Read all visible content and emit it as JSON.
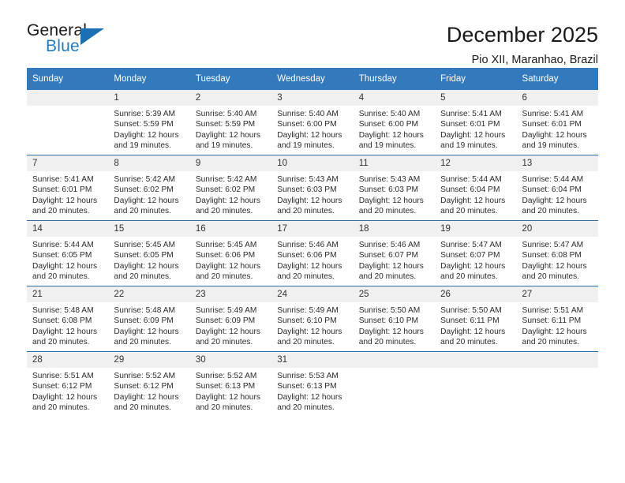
{
  "logo": {
    "word_top": "General",
    "word_bottom": "Blue",
    "triangle_color": "#1a6fb5",
    "blue_color": "#1f7cc4"
  },
  "header": {
    "title": "December 2025",
    "subtitle": "Pio XII, Maranhao, Brazil"
  },
  "calendar": {
    "header_bg": "#3279bd",
    "header_text_color": "#ffffff",
    "daynum_bg": "#f0f0f0",
    "row_divider_color": "#2e6da4",
    "weekdays": [
      "Sunday",
      "Monday",
      "Tuesday",
      "Wednesday",
      "Thursday",
      "Friday",
      "Saturday"
    ],
    "weeks": [
      [
        {
          "day": "",
          "sunrise": "",
          "sunset": "",
          "daylight_1": "",
          "daylight_2": ""
        },
        {
          "day": "1",
          "sunrise": "Sunrise: 5:39 AM",
          "sunset": "Sunset: 5:59 PM",
          "daylight_1": "Daylight: 12 hours",
          "daylight_2": "and 19 minutes."
        },
        {
          "day": "2",
          "sunrise": "Sunrise: 5:40 AM",
          "sunset": "Sunset: 5:59 PM",
          "daylight_1": "Daylight: 12 hours",
          "daylight_2": "and 19 minutes."
        },
        {
          "day": "3",
          "sunrise": "Sunrise: 5:40 AM",
          "sunset": "Sunset: 6:00 PM",
          "daylight_1": "Daylight: 12 hours",
          "daylight_2": "and 19 minutes."
        },
        {
          "day": "4",
          "sunrise": "Sunrise: 5:40 AM",
          "sunset": "Sunset: 6:00 PM",
          "daylight_1": "Daylight: 12 hours",
          "daylight_2": "and 19 minutes."
        },
        {
          "day": "5",
          "sunrise": "Sunrise: 5:41 AM",
          "sunset": "Sunset: 6:01 PM",
          "daylight_1": "Daylight: 12 hours",
          "daylight_2": "and 19 minutes."
        },
        {
          "day": "6",
          "sunrise": "Sunrise: 5:41 AM",
          "sunset": "Sunset: 6:01 PM",
          "daylight_1": "Daylight: 12 hours",
          "daylight_2": "and 19 minutes."
        }
      ],
      [
        {
          "day": "7",
          "sunrise": "Sunrise: 5:41 AM",
          "sunset": "Sunset: 6:01 PM",
          "daylight_1": "Daylight: 12 hours",
          "daylight_2": "and 20 minutes."
        },
        {
          "day": "8",
          "sunrise": "Sunrise: 5:42 AM",
          "sunset": "Sunset: 6:02 PM",
          "daylight_1": "Daylight: 12 hours",
          "daylight_2": "and 20 minutes."
        },
        {
          "day": "9",
          "sunrise": "Sunrise: 5:42 AM",
          "sunset": "Sunset: 6:02 PM",
          "daylight_1": "Daylight: 12 hours",
          "daylight_2": "and 20 minutes."
        },
        {
          "day": "10",
          "sunrise": "Sunrise: 5:43 AM",
          "sunset": "Sunset: 6:03 PM",
          "daylight_1": "Daylight: 12 hours",
          "daylight_2": "and 20 minutes."
        },
        {
          "day": "11",
          "sunrise": "Sunrise: 5:43 AM",
          "sunset": "Sunset: 6:03 PM",
          "daylight_1": "Daylight: 12 hours",
          "daylight_2": "and 20 minutes."
        },
        {
          "day": "12",
          "sunrise": "Sunrise: 5:44 AM",
          "sunset": "Sunset: 6:04 PM",
          "daylight_1": "Daylight: 12 hours",
          "daylight_2": "and 20 minutes."
        },
        {
          "day": "13",
          "sunrise": "Sunrise: 5:44 AM",
          "sunset": "Sunset: 6:04 PM",
          "daylight_1": "Daylight: 12 hours",
          "daylight_2": "and 20 minutes."
        }
      ],
      [
        {
          "day": "14",
          "sunrise": "Sunrise: 5:44 AM",
          "sunset": "Sunset: 6:05 PM",
          "daylight_1": "Daylight: 12 hours",
          "daylight_2": "and 20 minutes."
        },
        {
          "day": "15",
          "sunrise": "Sunrise: 5:45 AM",
          "sunset": "Sunset: 6:05 PM",
          "daylight_1": "Daylight: 12 hours",
          "daylight_2": "and 20 minutes."
        },
        {
          "day": "16",
          "sunrise": "Sunrise: 5:45 AM",
          "sunset": "Sunset: 6:06 PM",
          "daylight_1": "Daylight: 12 hours",
          "daylight_2": "and 20 minutes."
        },
        {
          "day": "17",
          "sunrise": "Sunrise: 5:46 AM",
          "sunset": "Sunset: 6:06 PM",
          "daylight_1": "Daylight: 12 hours",
          "daylight_2": "and 20 minutes."
        },
        {
          "day": "18",
          "sunrise": "Sunrise: 5:46 AM",
          "sunset": "Sunset: 6:07 PM",
          "daylight_1": "Daylight: 12 hours",
          "daylight_2": "and 20 minutes."
        },
        {
          "day": "19",
          "sunrise": "Sunrise: 5:47 AM",
          "sunset": "Sunset: 6:07 PM",
          "daylight_1": "Daylight: 12 hours",
          "daylight_2": "and 20 minutes."
        },
        {
          "day": "20",
          "sunrise": "Sunrise: 5:47 AM",
          "sunset": "Sunset: 6:08 PM",
          "daylight_1": "Daylight: 12 hours",
          "daylight_2": "and 20 minutes."
        }
      ],
      [
        {
          "day": "21",
          "sunrise": "Sunrise: 5:48 AM",
          "sunset": "Sunset: 6:08 PM",
          "daylight_1": "Daylight: 12 hours",
          "daylight_2": "and 20 minutes."
        },
        {
          "day": "22",
          "sunrise": "Sunrise: 5:48 AM",
          "sunset": "Sunset: 6:09 PM",
          "daylight_1": "Daylight: 12 hours",
          "daylight_2": "and 20 minutes."
        },
        {
          "day": "23",
          "sunrise": "Sunrise: 5:49 AM",
          "sunset": "Sunset: 6:09 PM",
          "daylight_1": "Daylight: 12 hours",
          "daylight_2": "and 20 minutes."
        },
        {
          "day": "24",
          "sunrise": "Sunrise: 5:49 AM",
          "sunset": "Sunset: 6:10 PM",
          "daylight_1": "Daylight: 12 hours",
          "daylight_2": "and 20 minutes."
        },
        {
          "day": "25",
          "sunrise": "Sunrise: 5:50 AM",
          "sunset": "Sunset: 6:10 PM",
          "daylight_1": "Daylight: 12 hours",
          "daylight_2": "and 20 minutes."
        },
        {
          "day": "26",
          "sunrise": "Sunrise: 5:50 AM",
          "sunset": "Sunset: 6:11 PM",
          "daylight_1": "Daylight: 12 hours",
          "daylight_2": "and 20 minutes."
        },
        {
          "day": "27",
          "sunrise": "Sunrise: 5:51 AM",
          "sunset": "Sunset: 6:11 PM",
          "daylight_1": "Daylight: 12 hours",
          "daylight_2": "and 20 minutes."
        }
      ],
      [
        {
          "day": "28",
          "sunrise": "Sunrise: 5:51 AM",
          "sunset": "Sunset: 6:12 PM",
          "daylight_1": "Daylight: 12 hours",
          "daylight_2": "and 20 minutes."
        },
        {
          "day": "29",
          "sunrise": "Sunrise: 5:52 AM",
          "sunset": "Sunset: 6:12 PM",
          "daylight_1": "Daylight: 12 hours",
          "daylight_2": "and 20 minutes."
        },
        {
          "day": "30",
          "sunrise": "Sunrise: 5:52 AM",
          "sunset": "Sunset: 6:13 PM",
          "daylight_1": "Daylight: 12 hours",
          "daylight_2": "and 20 minutes."
        },
        {
          "day": "31",
          "sunrise": "Sunrise: 5:53 AM",
          "sunset": "Sunset: 6:13 PM",
          "daylight_1": "Daylight: 12 hours",
          "daylight_2": "and 20 minutes."
        },
        {
          "day": "",
          "sunrise": "",
          "sunset": "",
          "daylight_1": "",
          "daylight_2": ""
        },
        {
          "day": "",
          "sunrise": "",
          "sunset": "",
          "daylight_1": "",
          "daylight_2": ""
        },
        {
          "day": "",
          "sunrise": "",
          "sunset": "",
          "daylight_1": "",
          "daylight_2": ""
        }
      ]
    ]
  }
}
